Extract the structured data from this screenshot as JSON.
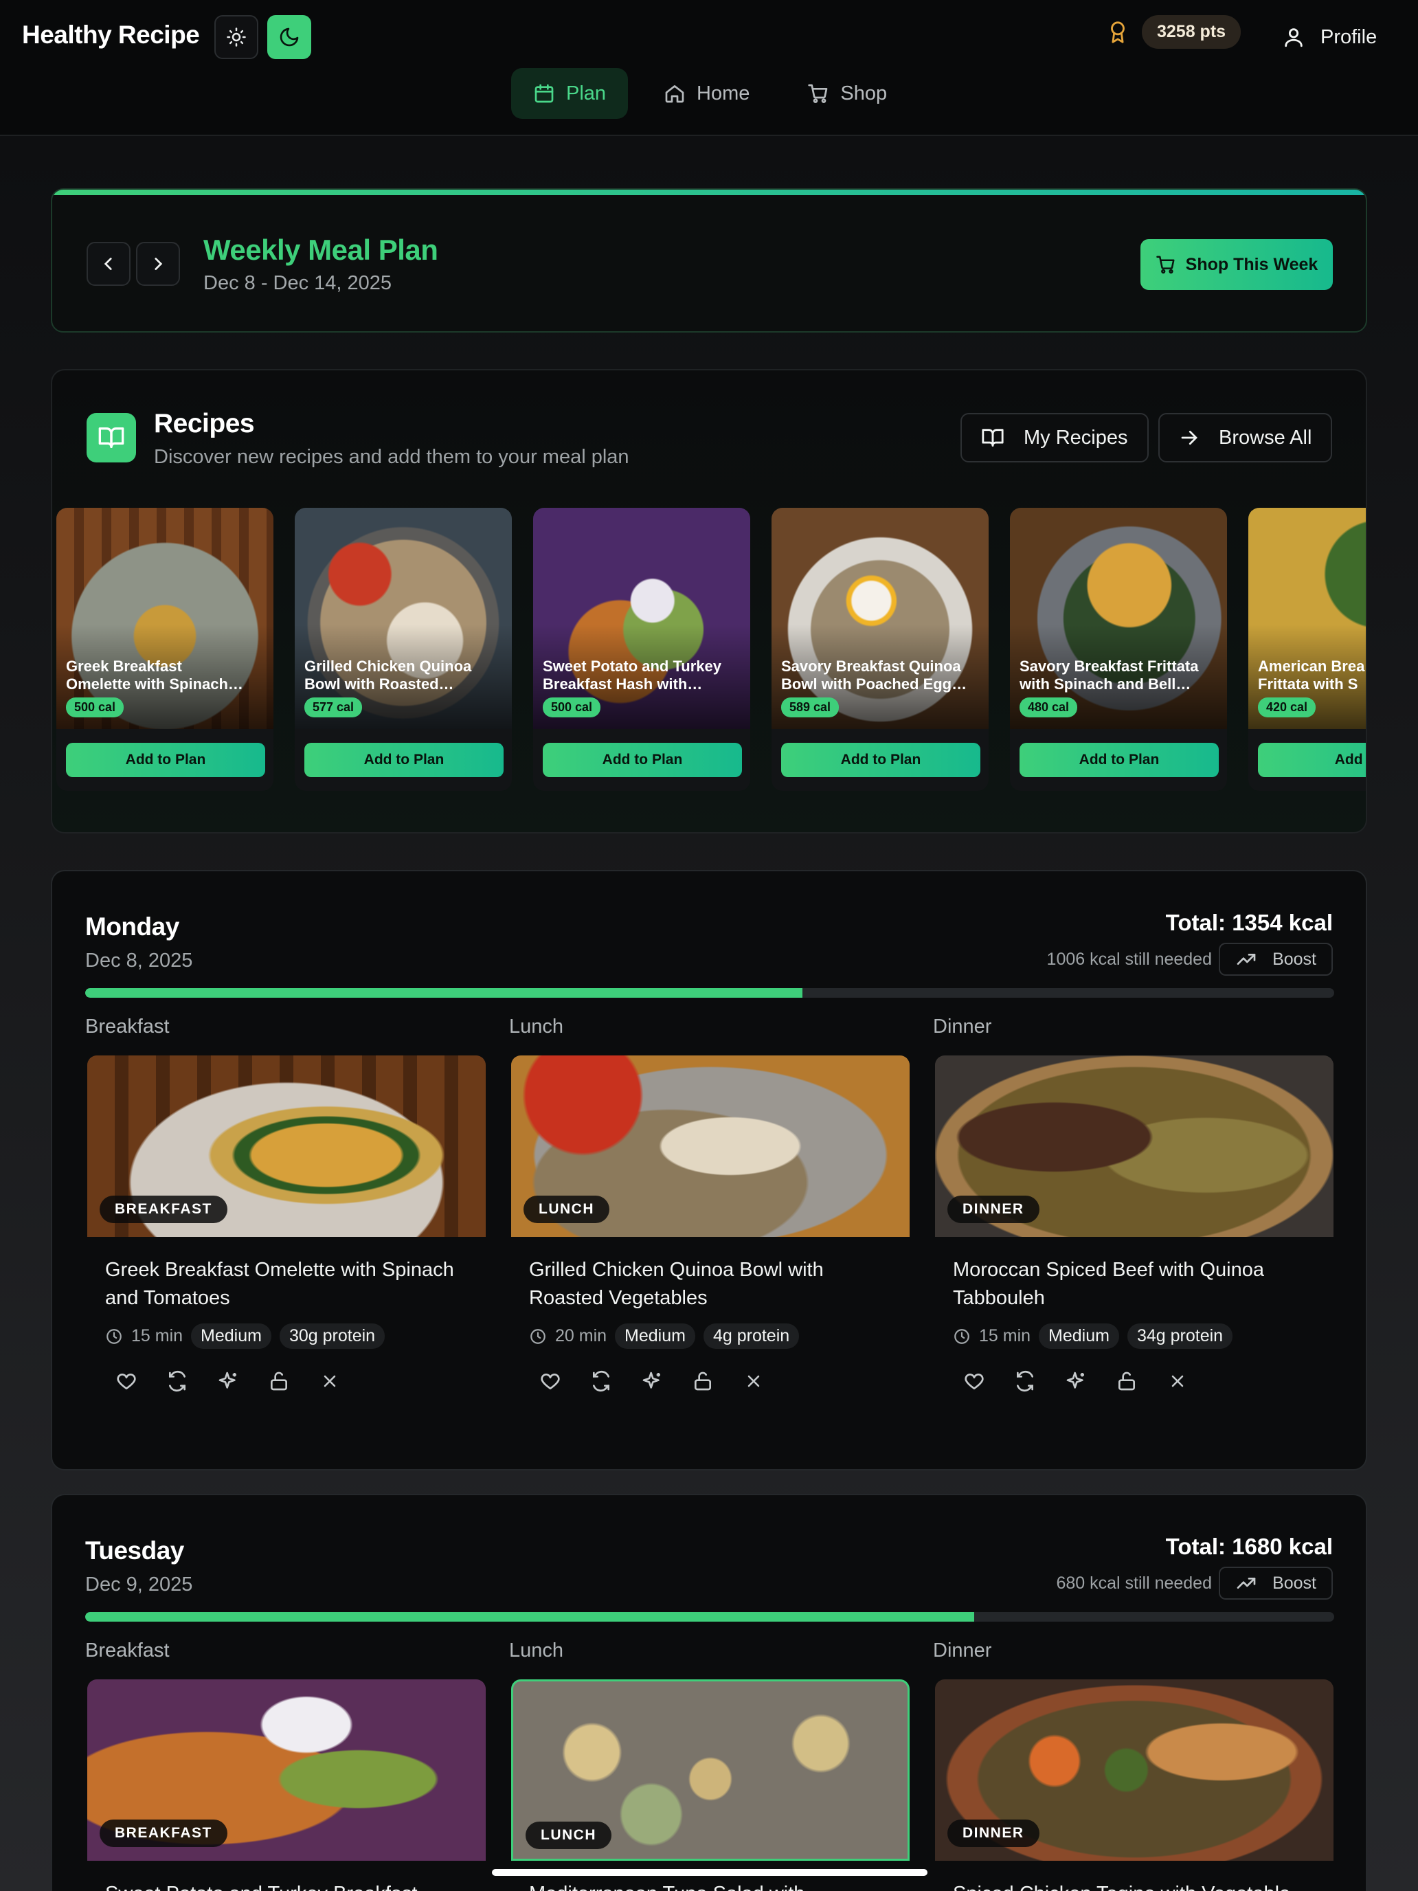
{
  "app": {
    "title": "Healthy Recipe"
  },
  "header": {
    "points": "3258 pts",
    "profile_label": "Profile"
  },
  "nav": {
    "tabs": [
      {
        "label": "Plan",
        "active": true
      },
      {
        "label": "Home",
        "active": false
      },
      {
        "label": "Shop",
        "active": false
      }
    ]
  },
  "week": {
    "title": "Weekly Meal Plan",
    "range": "Dec 8 - Dec 14, 2025",
    "shop_button": "Shop This Week"
  },
  "recipes": {
    "title": "Recipes",
    "subtitle": "Discover new recipes and add them to your meal plan",
    "my_recipes_label": "My Recipes",
    "browse_all_label": "Browse All",
    "items": [
      {
        "name_line1": "Greek Breakfast",
        "name_line2": "Omelette with Spinach…",
        "calories": "500 cal",
        "add_label": "Add to Plan"
      },
      {
        "name_line1": "Grilled Chicken Quinoa",
        "name_line2": "Bowl with Roasted…",
        "calories": "577 cal",
        "add_label": "Add to Plan"
      },
      {
        "name_line1": "Sweet Potato and Turkey",
        "name_line2": "Breakfast Hash with…",
        "calories": "500 cal",
        "add_label": "Add to Plan"
      },
      {
        "name_line1": "Savory Breakfast Quinoa",
        "name_line2": "Bowl with Poached Egg…",
        "calories": "589 cal",
        "add_label": "Add to Plan"
      },
      {
        "name_line1": "Savory Breakfast Frittata",
        "name_line2": "with Spinach and Bell…",
        "calories": "480 cal",
        "add_label": "Add to Plan"
      },
      {
        "name_line1": "American Brea",
        "name_line2": "Frittata with S",
        "calories": "420 cal",
        "add_label": "Add to"
      }
    ]
  },
  "days": [
    {
      "name": "Monday",
      "date": "Dec 8, 2025",
      "total": "Total: 1354 kcal",
      "needed": "1006 kcal still needed",
      "boost_label": "Boost",
      "progress": 0.574,
      "meals": [
        {
          "label": "Breakfast",
          "badge": "BREAKFAST",
          "title": "Greek Breakfast Omelette with Spinach and Tomatoes",
          "time": "15 min",
          "difficulty": "Medium",
          "protein": "30g protein"
        },
        {
          "label": "Lunch",
          "badge": "LUNCH",
          "title": "Grilled Chicken Quinoa Bowl with Roasted Vegetables",
          "time": "20 min",
          "difficulty": "Medium",
          "protein": "4g protein"
        },
        {
          "label": "Dinner",
          "badge": "DINNER",
          "title": "Moroccan Spiced Beef with Quinoa Tabbouleh",
          "time": "15 min",
          "difficulty": "Medium",
          "protein": "34g protein"
        }
      ]
    },
    {
      "name": "Tuesday",
      "date": "Dec 9, 2025",
      "total": "Total: 1680 kcal",
      "needed": "680 kcal still needed",
      "boost_label": "Boost",
      "progress": 0.712,
      "meals": [
        {
          "label": "Breakfast",
          "badge": "BREAKFAST",
          "title": "Sweet Potato and Turkey Breakfast"
        },
        {
          "label": "Lunch",
          "badge": "LUNCH",
          "title": "Mediterranean Tuna Salad with"
        },
        {
          "label": "Dinner",
          "badge": "DINNER",
          "title": "Spiced Chicken Tagine with Vegetable"
        }
      ]
    }
  ],
  "colors": {
    "accent": "#3ecf7a",
    "accent_teal": "#17b98d",
    "background": "#0c0d0f",
    "card": "#0b0c0d"
  },
  "icons": [
    "sun-icon",
    "moon-icon",
    "award-icon",
    "user-icon",
    "calendar-icon",
    "home-icon",
    "cart-icon",
    "chevron-left-icon",
    "chevron-right-icon",
    "book-open-icon",
    "arrow-right-icon",
    "trending-up-icon",
    "clock-icon",
    "heart-icon",
    "refresh-icon",
    "sparkles-icon",
    "unlock-icon",
    "close-icon"
  ]
}
